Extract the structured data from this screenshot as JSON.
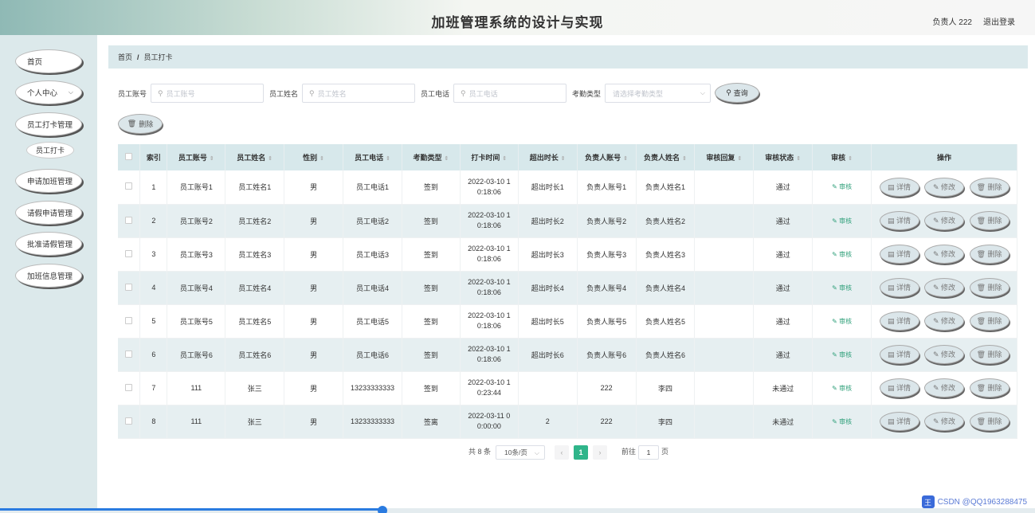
{
  "header": {
    "title": "加班管理系统的设计与实现",
    "user": "负责人 222",
    "logout": "退出登录"
  },
  "sidebar": {
    "items": [
      "首页",
      "个人中心",
      "员工打卡管理",
      "员工打卡",
      "申请加班管理",
      "请假申请管理",
      "批准请假管理",
      "加班信息管理"
    ]
  },
  "breadcrumb": {
    "home": "首页",
    "sep": "/",
    "current": "员工打卡"
  },
  "search": {
    "account_label": "员工账号",
    "account_placeholder": "员工账号",
    "name_label": "员工姓名",
    "name_placeholder": "员工姓名",
    "phone_label": "员工电话",
    "phone_placeholder": "员工电话",
    "type_label": "考勤类型",
    "type_placeholder": "请选择考勤类型",
    "query_button": "查询"
  },
  "toolbar": {
    "delete_button": "删除"
  },
  "table": {
    "headers": [
      "索引",
      "员工账号",
      "员工姓名",
      "性别",
      "员工电话",
      "考勤类型",
      "打卡时间",
      "超出时长",
      "负责人账号",
      "负责人姓名",
      "审核回复",
      "审核状态",
      "审核",
      "操作"
    ],
    "audit_link": "审核",
    "op_detail": "详情",
    "op_edit": "修改",
    "op_delete": "删除",
    "rows": [
      [
        "1",
        "员工账号1",
        "员工姓名1",
        "男",
        "员工电话1",
        "签到",
        "2022-03-10 1",
        "0:18:06",
        "超出时长1",
        "负责人账号1",
        "负责人姓名1",
        "",
        "通过"
      ],
      [
        "2",
        "员工账号2",
        "员工姓名2",
        "男",
        "员工电话2",
        "签到",
        "2022-03-10 1",
        "0:18:06",
        "超出时长2",
        "负责人账号2",
        "负责人姓名2",
        "",
        "通过"
      ],
      [
        "3",
        "员工账号3",
        "员工姓名3",
        "男",
        "员工电话3",
        "签到",
        "2022-03-10 1",
        "0:18:06",
        "超出时长3",
        "负责人账号3",
        "负责人姓名3",
        "",
        "通过"
      ],
      [
        "4",
        "员工账号4",
        "员工姓名4",
        "男",
        "员工电话4",
        "签到",
        "2022-03-10 1",
        "0:18:06",
        "超出时长4",
        "负责人账号4",
        "负责人姓名4",
        "",
        "通过"
      ],
      [
        "5",
        "员工账号5",
        "员工姓名5",
        "男",
        "员工电话5",
        "签到",
        "2022-03-10 1",
        "0:18:06",
        "超出时长5",
        "负责人账号5",
        "负责人姓名5",
        "",
        "通过"
      ],
      [
        "6",
        "员工账号6",
        "员工姓名6",
        "男",
        "员工电话6",
        "签到",
        "2022-03-10 1",
        "0:18:06",
        "超出时长6",
        "负责人账号6",
        "负责人姓名6",
        "",
        "通过"
      ],
      [
        "7",
        "111",
        "张三",
        "男",
        "13233333333",
        "签到",
        "2022-03-10 1",
        "0:23:44",
        "",
        "222",
        "李四",
        "",
        "未通过"
      ],
      [
        "8",
        "111",
        "张三",
        "男",
        "13233333333",
        "签离",
        "2022-03-11 0",
        "0:00:00",
        "2",
        "222",
        "李四",
        "",
        "未通过"
      ]
    ]
  },
  "pagination": {
    "total": "共 8 条",
    "page_size": "10条/页",
    "prev": "‹",
    "page": "1",
    "next": "›",
    "goto_label": "前往",
    "goto_value": "1",
    "goto_unit": "页"
  },
  "watermark": {
    "logo": "王",
    "text": "CSDN @QQ1963288475"
  }
}
